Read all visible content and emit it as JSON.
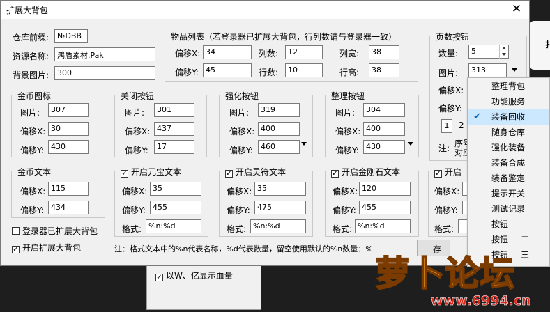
{
  "dialog": {
    "title": "扩展大背包",
    "close_glyph": "✕"
  },
  "warehouse": {
    "prefix_label": "仓库前缀:",
    "prefix_value": "№DBB",
    "resource_label": "资源名称:",
    "resource_value": "鸿盾素材.Pak",
    "bg_label": "背景图片:",
    "bg_value": "300"
  },
  "item_list": {
    "title": "物品列表（若登录器已扩展大背包，行列数请与登录器一致）",
    "offset_x_label": "偏移X:",
    "offset_x": "34",
    "offset_y_label": "偏移Y:",
    "offset_y": "45",
    "cols_label": "列数:",
    "cols": "12",
    "rows_label": "行数:",
    "rows": "10",
    "col_width_label": "列宽:",
    "col_width": "38",
    "row_height_label": "行高:",
    "row_height": "38"
  },
  "page_buttons": {
    "title": "页数按钮",
    "count_label": "数量:",
    "count": "5",
    "image_label": "图片:",
    "image": "313",
    "offset_x_label": "偏移X:",
    "offset_y_label": "偏移Y:",
    "page1": "1",
    "page2": "2",
    "note_label": "注:",
    "note_frag1": "序号",
    "note_frag2": "对应"
  },
  "gold_icon": {
    "title": "金币图标",
    "image_label": "图片:",
    "image": "307",
    "offset_x_label": "偏移X:",
    "offset_x": "30",
    "offset_y_label": "偏移Y:",
    "offset_y": "430"
  },
  "close_button": {
    "title": "关闭按钮",
    "image_label": "图片:",
    "image": "301",
    "offset_x_label": "偏移X:",
    "offset_x": "437",
    "offset_y_label": "偏移Y:",
    "offset_y": "17"
  },
  "enhance_button": {
    "title": "强化按钮",
    "image_label": "图片:",
    "image": "319",
    "offset_x_label": "偏移X:",
    "offset_x": "400",
    "offset_y_label": "偏移Y:",
    "offset_y": "460"
  },
  "sort_button": {
    "title": "整理按钮",
    "image_label": "图片:",
    "image": "304",
    "offset_x_label": "偏移X:",
    "offset_x": "400",
    "offset_y_label": "偏移Y:",
    "offset_y": "430"
  },
  "gold_text": {
    "title": "金币文本",
    "offset_x_label": "偏移X:",
    "offset_x": "115",
    "offset_y_label": "偏移Y:",
    "offset_y": "434"
  },
  "yuanbao_text": {
    "title": "开启元宝文本",
    "offset_x_label": "偏移X:",
    "offset_x": "35",
    "offset_y_label": "偏移Y:",
    "offset_y": "455",
    "format_label": "格式:",
    "format": "%n:%d"
  },
  "lingfu_text": {
    "title": "开启灵符文本",
    "offset_x_label": "偏移X:",
    "offset_x": "35",
    "offset_y_label": "偏移Y:",
    "offset_y": "475",
    "format_label": "格式:",
    "format": "%n:%d"
  },
  "diamond_text": {
    "title": "开启金刚石文本",
    "offset_x_label": "偏移X:",
    "offset_x": "120",
    "offset_y_label": "偏移Y:",
    "offset_y": "455",
    "format_label": "格式:",
    "format": "%n:%d"
  },
  "partial_text": {
    "title": "开启",
    "offset_x_label": "偏移X:",
    "offset_y_label": "偏移Y:",
    "format_label": "格式:"
  },
  "checkboxes": {
    "login_extended": "登录器已扩展大背包",
    "login_extended_checked": false,
    "enable_big_bag": "开启扩展大背包",
    "enable_big_bag_checked": true,
    "bg_window_option": "以W、亿显示血量",
    "bg_window_option_checked": true
  },
  "footer_note": "注：格式文本中的%n代表名称，%d代表数量，留空使用默认的%n数量：%",
  "footer_button_frag": "存",
  "context_menu": {
    "items": [
      {
        "label": "整理背包",
        "checked": false
      },
      {
        "label": "功能服务",
        "checked": false
      },
      {
        "label": "装备回收",
        "checked": true
      },
      {
        "label": "随身仓库",
        "checked": false
      },
      {
        "label": "强化装备",
        "checked": false
      },
      {
        "label": "装备合成",
        "checked": false
      },
      {
        "label": "装备鉴定",
        "checked": false
      },
      {
        "label": "提示开关",
        "checked": false
      },
      {
        "label": "测试记录",
        "checked": false
      },
      {
        "label": "按钮",
        "suffix": "一",
        "checked": false
      },
      {
        "label": "按钮",
        "suffix": "二",
        "checked": false
      },
      {
        "label": "按钮",
        "suffix": "三",
        "checked": false
      }
    ],
    "check_glyph": "✔"
  },
  "watermark": {
    "brand": "萝卜论坛",
    "url": "www.6994.cn"
  },
  "colors": {
    "dialog_bg": "#f0f0f0",
    "menu_highlight": "#cce8ff",
    "check_blue": "#0067c0",
    "logo_orange": "#f7a21b",
    "logo_red": "#d8281c"
  }
}
